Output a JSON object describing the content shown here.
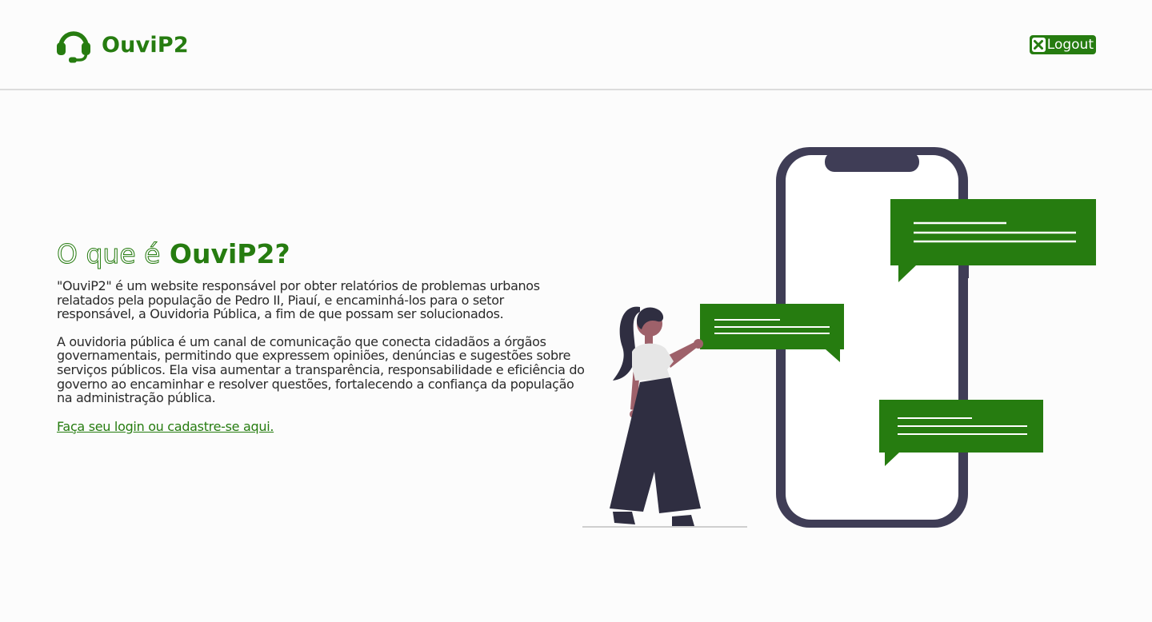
{
  "header": {
    "brand_name": "OuviP2",
    "logout_label": "Logout"
  },
  "main": {
    "heading_prefix": "O que é",
    "heading_brand": "OuviP2?",
    "paragraph_1": "\"OuviP2\" é um website responsável por obter relatórios de problemas urbanos relatados pela população de Pedro II, Piauí, e encaminhá-los para o setor responsável, a Ouvidoria Pública, a fim de que possam ser solucionados.",
    "paragraph_2": "A ouvidoria pública é um canal de comunicação que conecta cidadãos a órgãos governamentais, permitindo que expressem opiniões, denúncias e sugestões sobre serviços públicos. Ela visa aumentar a transparência, responsabilidade e eficiência do governo ao encaminhar e resolver questões, fortalecendo a confiança da população na administração pública.",
    "login_link": "Faça seu login ou cadastre-se aqui."
  },
  "icons": {
    "brand": "headset-icon",
    "logout": "close-x-icon"
  },
  "colors": {
    "brand_green": "#267c10",
    "phone_frame": "#3f3d56",
    "background": "#fcfcfc"
  }
}
